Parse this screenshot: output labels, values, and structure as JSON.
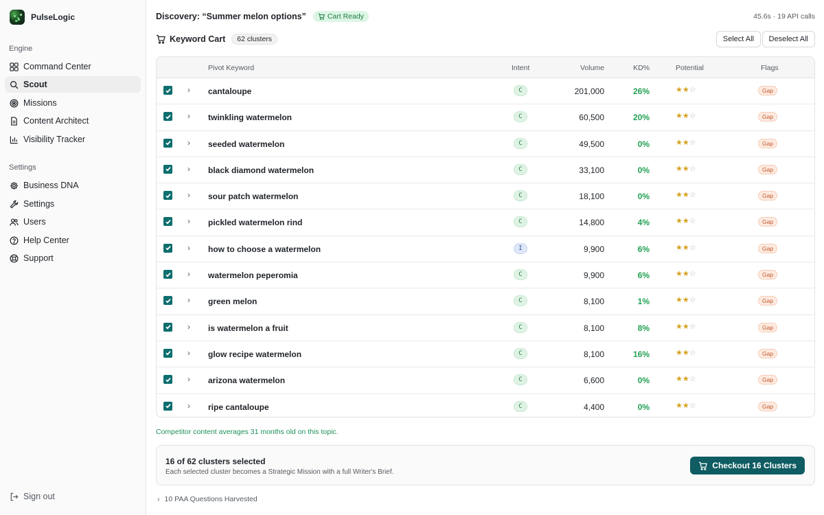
{
  "app": {
    "name": "PulseLogic"
  },
  "sidebar": {
    "engine_label": "Engine",
    "engine_items": [
      {
        "label": "Command Center",
        "icon": "grid-icon"
      },
      {
        "label": "Scout",
        "icon": "search-icon",
        "active": true
      },
      {
        "label": "Missions",
        "icon": "target-icon"
      },
      {
        "label": "Content Architect",
        "icon": "document-icon"
      },
      {
        "label": "Visibility Tracker",
        "icon": "bar-chart-icon"
      }
    ],
    "settings_label": "Settings",
    "settings_items": [
      {
        "label": "Business DNA",
        "icon": "gear-icon"
      },
      {
        "label": "Settings",
        "icon": "wrench-icon"
      },
      {
        "label": "Users",
        "icon": "users-icon"
      },
      {
        "label": "Help Center",
        "icon": "help-circle-icon"
      },
      {
        "label": "Support",
        "icon": "lifebuoy-icon"
      }
    ],
    "sign_out": "Sign out"
  },
  "header": {
    "discovery": "Discovery: “Summer melon options”",
    "status_badge": "Cart Ready",
    "timing": "45.6s · 19 API calls"
  },
  "cart": {
    "title": "Keyword Cart",
    "clusters_pill": "62 clusters",
    "select_all": "Select All",
    "deselect_all": "Deselect All"
  },
  "table": {
    "columns": {
      "keyword": "Pivot Keyword",
      "intent": "Intent",
      "volume": "Volume",
      "kd": "KD%",
      "potential": "Potential",
      "flags": "Flags"
    },
    "rows": [
      {
        "keyword": "cantaloupe",
        "intent": "C",
        "volume": "201,000",
        "kd": "26%",
        "potential": 2,
        "flag": "Gap",
        "checked": true
      },
      {
        "keyword": "twinkling watermelon",
        "intent": "C",
        "volume": "60,500",
        "kd": "20%",
        "potential": 2,
        "flag": "Gap",
        "checked": true
      },
      {
        "keyword": "seeded watermelon",
        "intent": "C",
        "volume": "49,500",
        "kd": "0%",
        "potential": 2,
        "flag": "Gap",
        "checked": true
      },
      {
        "keyword": "black diamond watermelon",
        "intent": "C",
        "volume": "33,100",
        "kd": "0%",
        "potential": 2,
        "flag": "Gap",
        "checked": true
      },
      {
        "keyword": "sour patch watermelon",
        "intent": "C",
        "volume": "18,100",
        "kd": "0%",
        "potential": 2,
        "flag": "Gap",
        "checked": true
      },
      {
        "keyword": "pickled watermelon rind",
        "intent": "C",
        "volume": "14,800",
        "kd": "4%",
        "potential": 2,
        "flag": "Gap",
        "checked": true
      },
      {
        "keyword": "how to choose a watermelon",
        "intent": "I",
        "volume": "9,900",
        "kd": "6%",
        "potential": 2,
        "flag": "Gap",
        "checked": true
      },
      {
        "keyword": "watermelon peperomia",
        "intent": "C",
        "volume": "9,900",
        "kd": "6%",
        "potential": 2,
        "flag": "Gap",
        "checked": true
      },
      {
        "keyword": "green melon",
        "intent": "C",
        "volume": "8,100",
        "kd": "1%",
        "potential": 2,
        "flag": "Gap",
        "checked": true
      },
      {
        "keyword": "is watermelon a fruit",
        "intent": "C",
        "volume": "8,100",
        "kd": "8%",
        "potential": 2,
        "flag": "Gap",
        "checked": true
      },
      {
        "keyword": "glow recipe watermelon",
        "intent": "C",
        "volume": "8,100",
        "kd": "16%",
        "potential": 2,
        "flag": "Gap",
        "checked": true
      },
      {
        "keyword": "arizona watermelon",
        "intent": "C",
        "volume": "6,600",
        "kd": "0%",
        "potential": 2,
        "flag": "Gap",
        "checked": true
      },
      {
        "keyword": "ripe cantaloupe",
        "intent": "C",
        "volume": "4,400",
        "kd": "0%",
        "potential": 2,
        "flag": "Gap",
        "checked": true
      }
    ]
  },
  "insight": "Competitor content averages 31 months old on this topic.",
  "checkout": {
    "selected_text": "16 of 62 clusters selected",
    "subtext": "Each selected cluster becomes a Strategic Mission with a full Writer's Brief.",
    "button": "Checkout 16 Clusters"
  },
  "paa": "10 PAA Questions Harvested",
  "colors": {
    "primary": "#0f5c62",
    "checkbox": "#0f6e6e",
    "kd_green": "#22a154",
    "flag_orange": "#c0552b",
    "star_gold": "#d4a11e"
  }
}
